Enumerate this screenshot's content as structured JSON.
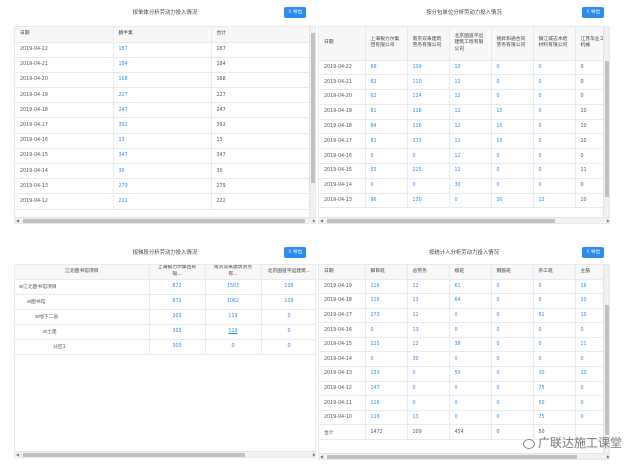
{
  "export_label": "导出",
  "panel_main": {
    "title": "按单体分析劳动力投入情况",
    "headers": [
      "日期",
      "翻半集",
      "合计"
    ],
    "rows": [
      [
        "2019-04-22",
        "187",
        "187"
      ],
      [
        "2019-04-21",
        "184",
        "184"
      ],
      [
        "2019-04-20",
        "168",
        "168"
      ],
      [
        "2019-04-19",
        "227",
        "227"
      ],
      [
        "2019-04-18",
        "247",
        "247"
      ],
      [
        "2019-04-17",
        "392",
        "392"
      ],
      [
        "2019-04-16",
        "13",
        "13"
      ],
      [
        "2019-04-15",
        "347",
        "347"
      ],
      [
        "2019-04-14",
        "30",
        "30"
      ],
      [
        "2019-04-13",
        "279",
        "279"
      ],
      [
        "2019-04-12",
        "222",
        "222"
      ]
    ]
  },
  "panel_sub": {
    "title": "按分包单位分析劳动力投入情况",
    "headers": [
      "日期",
      "上海银力尔集团有限公司",
      "南京双来建筑劳务有限公司",
      "北京国道平运建筑工程有限公司",
      "德昇和通合同劳务有限公司",
      "镇江城志木结材料有限公司",
      "江苏华业工程机械"
    ],
    "rows": [
      [
        "2019-04-22",
        "68",
        "109",
        "10",
        "0",
        "0",
        "0"
      ],
      [
        "2019-04-21",
        "62",
        "110",
        "12",
        "0",
        "0",
        "0"
      ],
      [
        "2019-04-20",
        "62",
        "114",
        "12",
        "0",
        "0",
        "0"
      ],
      [
        "2019-04-19",
        "81",
        "118",
        "12",
        "15",
        "0",
        "10"
      ],
      [
        "2019-04-18",
        "84",
        "116",
        "12",
        "15",
        "0",
        "10"
      ],
      [
        "2019-04-17",
        "81",
        "273",
        "12",
        "15",
        "0",
        "10"
      ],
      [
        "2019-04-16",
        "0",
        "0",
        "12",
        "0",
        "0",
        "0"
      ],
      [
        "2019-04-15",
        "55",
        "225",
        "12",
        "0",
        "0",
        "11"
      ],
      [
        "2019-04-14",
        "0",
        "0",
        "30",
        "0",
        "0",
        "0"
      ],
      [
        "2019-04-13",
        "96",
        "130",
        "0",
        "30",
        "13",
        "10"
      ]
    ]
  },
  "panel_tree": {
    "title": "按梯段分析劳动力投入情况",
    "headers": [
      "江北图书馆项目",
      "上海银力尔集团有限...",
      "南京双来建筑劳务有...",
      "北京国道平运建筑..."
    ],
    "rows": [
      {
        "toggle": "⊟",
        "name": "江北图书馆项目",
        "v1": "872",
        "v2": "1503",
        "v3": "109"
      },
      {
        "toggle": "⊟",
        "name": "图书馆",
        "v1": "872",
        "v2": "1062",
        "v3": "109"
      },
      {
        "toggle": "⊟",
        "name": "地下二层",
        "v1": "303",
        "v2": "119",
        "v3": "0"
      },
      {
        "toggle": "⊟",
        "name": "土建",
        "v1": "303",
        "v2": "119",
        "v3": "0"
      },
      {
        "toggle": "",
        "name": "分区1",
        "v1": "303",
        "v2": "0",
        "v3": "0"
      }
    ]
  },
  "panel_worker": {
    "title": "按统计人分析劳动力投入情况",
    "headers": [
      "日期",
      "脚目班",
      "总劳务",
      "模班",
      "钢筋班",
      "杂工班",
      "主筋"
    ],
    "rows": [
      [
        "2019-04-19",
        "116",
        "12",
        "61",
        "0",
        "0",
        "16"
      ],
      [
        "2019-04-18",
        "116",
        "13",
        "64",
        "0",
        "0",
        "10"
      ],
      [
        "2019-04-17",
        "273",
        "12",
        "0",
        "0",
        "61",
        "10"
      ],
      [
        "2019-04-16",
        "0",
        "13",
        "0",
        "0",
        "0",
        "0"
      ],
      [
        "2019-04-15",
        "225",
        "12",
        "38",
        "0",
        "0",
        "11"
      ],
      [
        "2019-04-14",
        "0",
        "30",
        "0",
        "0",
        "0",
        "0"
      ],
      [
        "2019-04-13",
        "130",
        "0",
        "50",
        "0",
        "30",
        "10"
      ],
      [
        "2019-04-12",
        "147",
        "0",
        "0",
        "0",
        "75",
        "0"
      ],
      [
        "2019-04-11",
        "116",
        "0",
        "0",
        "0",
        "50",
        "0"
      ],
      [
        "2019-04-10",
        "116",
        "13",
        "0",
        "0",
        "75",
        "0"
      ]
    ],
    "total": [
      "合计",
      "1472",
      "109",
      "454",
      "0",
      "50",
      ""
    ]
  },
  "watermark": "广联达施工课堂"
}
